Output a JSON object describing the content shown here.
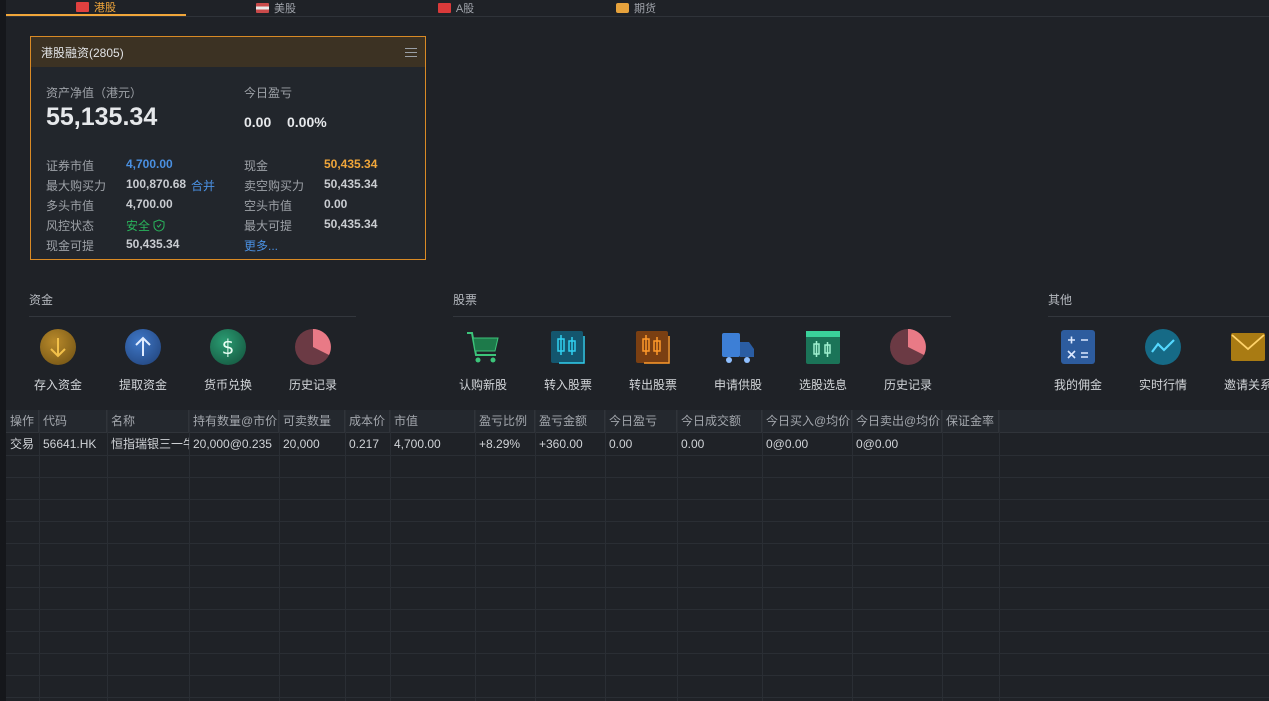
{
  "tabs": [
    {
      "label": "港股",
      "icon": "hk-flag-icon",
      "active": true
    },
    {
      "label": "美股",
      "icon": "us-flag-icon",
      "active": false
    },
    {
      "label": "A股",
      "icon": "cn-flag-icon",
      "active": false
    },
    {
      "label": "期货",
      "icon": "futures-stack-icon",
      "active": false
    }
  ],
  "account": {
    "title": "港股融资(2805)",
    "net_asset_label": "资产净值（港元）",
    "net_asset_value": "55,135.34",
    "today_pl_label": "今日盈亏",
    "today_pl_value": "0.00",
    "today_pl_percent": "0.00%",
    "rows": {
      "securities_value_label": "证券市值",
      "securities_value": "4,700.00",
      "cash_label": "现金",
      "cash": "50,435.34",
      "max_buy_label": "最大购买力",
      "max_buy": "100,870.68",
      "merge_link": "合并",
      "short_buy_label": "卖空购买力",
      "short_buy": "50,435.34",
      "long_value_label": "多头市值",
      "long_value": "4,700.00",
      "short_value_label": "空头市值",
      "short_value": "0.00",
      "risk_label": "风控状态",
      "risk": "安全",
      "max_withdraw_label": "最大可提",
      "max_withdraw": "50,435.34",
      "cash_withdraw_label": "现金可提",
      "cash_withdraw": "50,435.34",
      "more_link": "更多..."
    }
  },
  "sections": {
    "funds": {
      "title": "资金",
      "actions": [
        "存入资金",
        "提取资金",
        "货币兑换",
        "历史记录"
      ]
    },
    "stocks": {
      "title": "股票",
      "actions": [
        "认购新股",
        "转入股票",
        "转出股票",
        "申请供股",
        "选股选息",
        "历史记录"
      ]
    },
    "other": {
      "title": "其他",
      "actions": [
        "我的佣金",
        "实时行情",
        "邀请关系"
      ]
    }
  },
  "colors": {
    "accent": "#f0a63a",
    "link": "#4a90e2",
    "gain": "#e0403f",
    "safe": "#29b35b"
  },
  "table": {
    "headers": [
      "操作",
      "代码",
      "名称",
      "持有数量@市价",
      "可卖数量",
      "成本价",
      "市值",
      "盈亏比例",
      "盈亏金额",
      "今日盈亏",
      "今日成交额",
      "今日买入@均价",
      "今日卖出@均价",
      "保证金率"
    ],
    "rows": [
      {
        "action": "交易",
        "code": "56641.HK",
        "name": "恒指瑞银三一牛",
        "qty_price": "20,000@0.235",
        "sellable": "20,000",
        "cost": "0.217",
        "market_value": "4,700.00",
        "pl_ratio": "+8.29%",
        "pl_amount": "+360.00",
        "today_pl": "0.00",
        "today_turnover": "0.00",
        "today_buy": "0@0.00",
        "today_sell": "0@0.00",
        "margin_rate": ""
      }
    ]
  }
}
